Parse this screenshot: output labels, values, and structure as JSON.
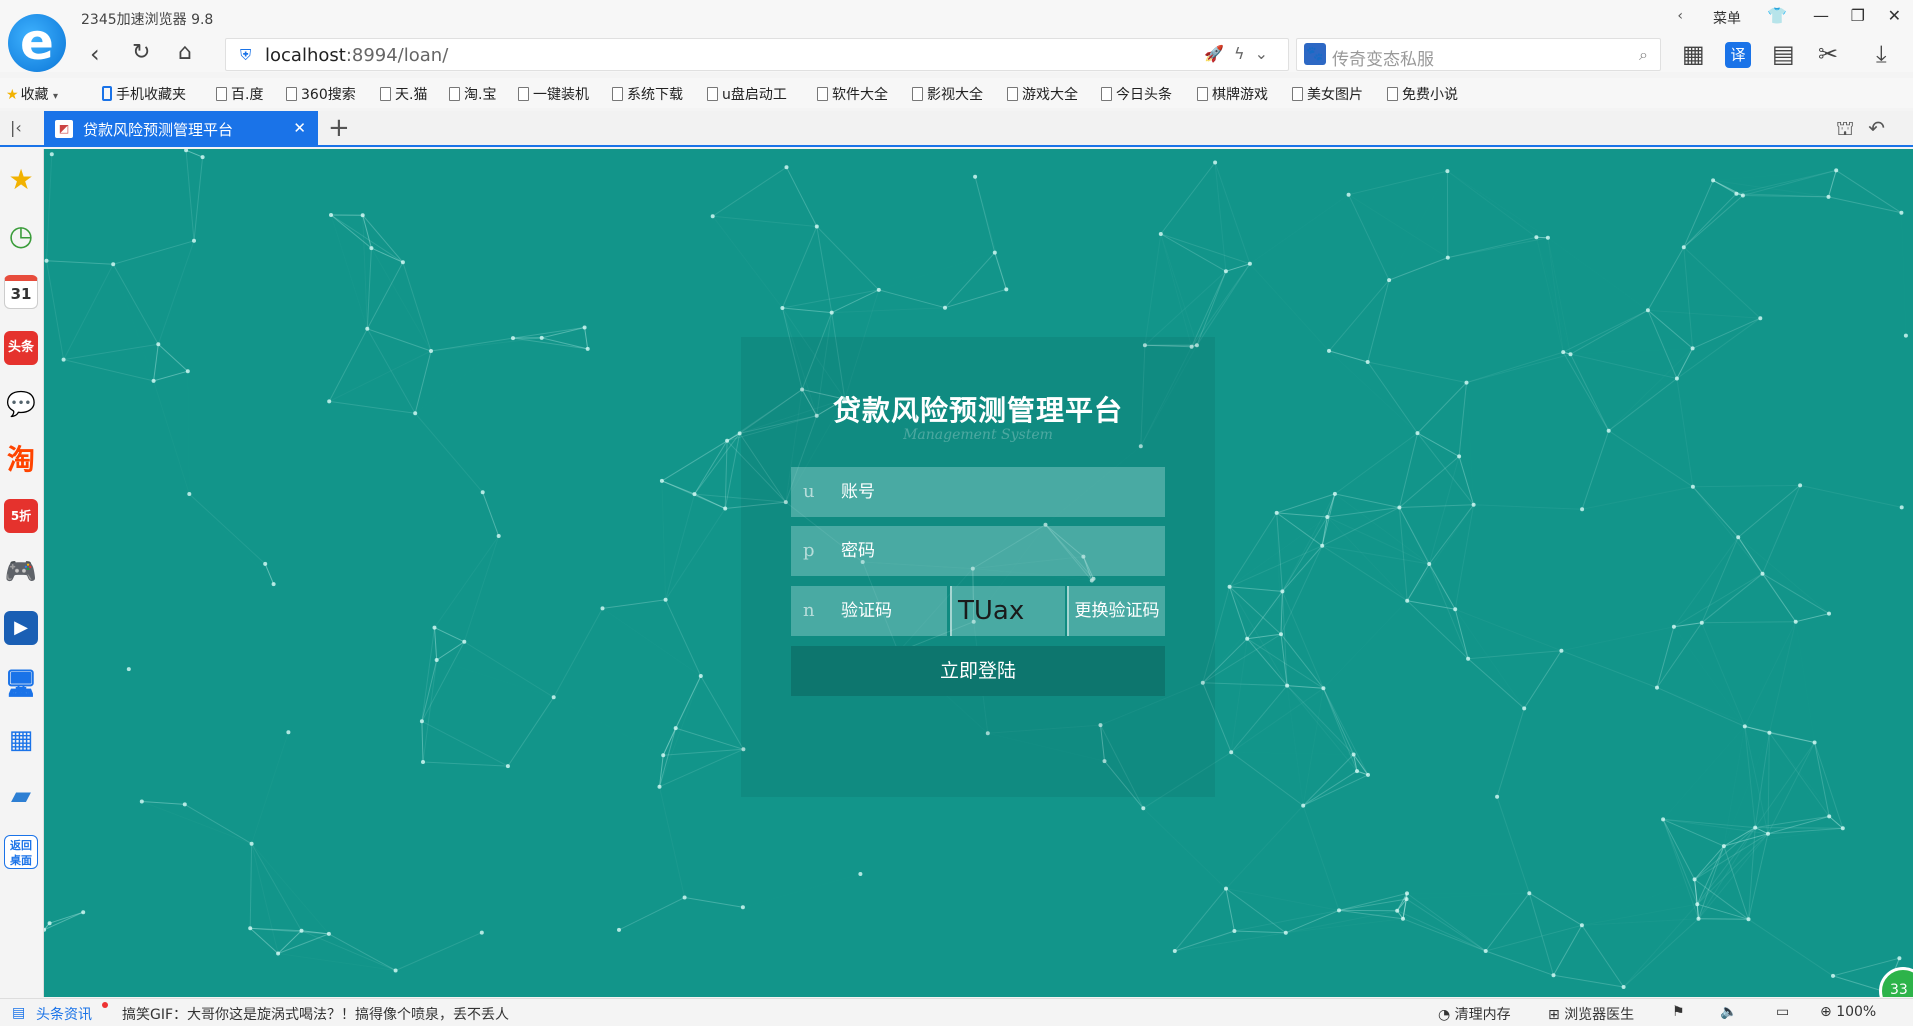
{
  "browser": {
    "title": "2345加速浏览器 9.8",
    "menu_label": "菜单",
    "url_host": "localhost",
    "url_rest": ":8994/loan/",
    "search_placeholder": "传奇变态私服"
  },
  "bookmarks": [
    "收藏",
    "手机收藏夹",
    "百.度",
    "360搜索",
    "天.猫",
    "淘.宝",
    "一键装机",
    "系统下载",
    "u盘启动工",
    "软件大全",
    "影视大全",
    "游戏大全",
    "今日头条",
    "棋牌游戏",
    "美女图片",
    "免费小说"
  ],
  "tab": {
    "title": "贷款风险预测管理平台"
  },
  "sidebar": {
    "calendar_day": "31",
    "toutiao": "头条",
    "taobao": "淘",
    "discount": "5折",
    "desktop": "返回桌面"
  },
  "login": {
    "title": "贷款风险预测管理平台",
    "subtitle": "Management System",
    "account_prefix": "u",
    "account_placeholder": "账号",
    "password_prefix": "p",
    "password_placeholder": "密码",
    "captcha_prefix": "n",
    "captcha_placeholder": "验证码",
    "captcha_text": "TUax",
    "refresh_captcha": "更换验证码",
    "submit": "立即登陆"
  },
  "float_badge": "33",
  "status": {
    "news_label": "头条资讯",
    "news_text": "搞笑GIF：大哥你这是旋涡式喝法？！搞得像个喷泉，丢不丢人",
    "clean_memory": "清理内存",
    "browser_doctor": "浏览器医生",
    "zoom": "100%"
  },
  "colors": {
    "content_bg": "#12958a",
    "tab_accent": "#1a73e8",
    "login_button": "#0d766e"
  }
}
